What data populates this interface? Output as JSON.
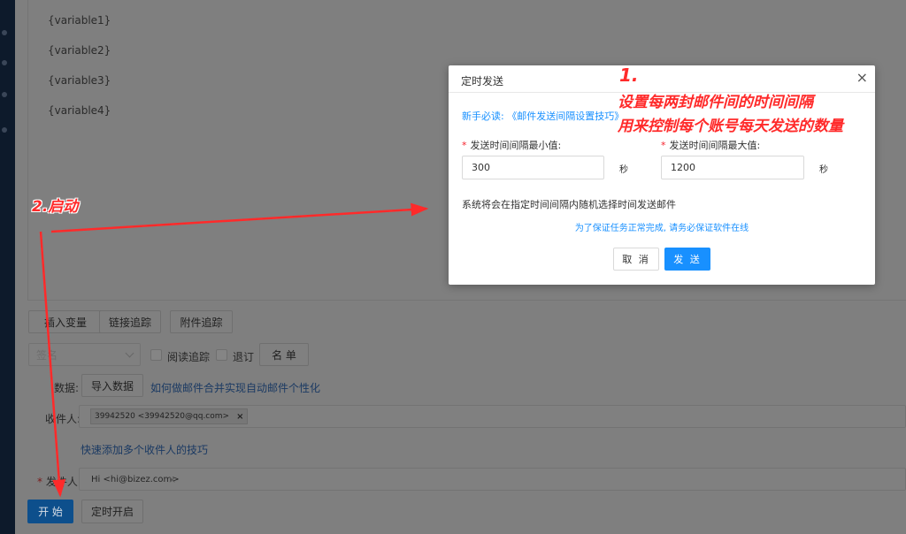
{
  "editor": {
    "variables": [
      "{variable1}",
      "{variable2}",
      "{variable3}",
      "{variable4}"
    ]
  },
  "toolbar": {
    "insert_variable": "插入变量",
    "link_tracking": "链接追踪",
    "attachment_tracking": "附件追踪"
  },
  "options": {
    "signature_placeholder": "签名",
    "read_tracking": "阅读追踪",
    "unsubscribe": "退订",
    "list_button": "名 单"
  },
  "data_row": {
    "label": "数据:",
    "import_button": "导入数据",
    "help_link": "如何做邮件合并实现自动邮件个性化"
  },
  "recipients": {
    "label": "收件人:",
    "tag": "39942520 <39942520@qq.com>",
    "tip_link": "快速添加多个收件人的技巧"
  },
  "sender": {
    "label": "发件人:",
    "value": "Hi <hi@bizez.com>"
  },
  "actions": {
    "start": "开 始",
    "schedule": "定时开启"
  },
  "modal": {
    "title": "定时发送",
    "tip": "新手必读: 《邮件发送间隔设置技巧》",
    "min_label": "发送时间间隔最小值:",
    "max_label": "发送时间间隔最大值:",
    "min_value": "300",
    "max_value": "1200",
    "unit": "秒",
    "description": "系统将会在指定时间间隔内随机选择时间发送邮件",
    "note": "为了保证任务正常完成, 请务必保证软件在线",
    "cancel": "取 消",
    "send": "发 送"
  },
  "annotations": {
    "step1_number": "1.",
    "step1_line1": "设置每两封邮件间的时间间隔",
    "step1_line2": "用来控制每个账号每天发送的数量",
    "step2": "2.启动",
    "color": "#ff2a2a"
  },
  "colors": {
    "primary": "#1890ff",
    "sidebar": "#0d1a2b",
    "required": "#f5222d"
  }
}
